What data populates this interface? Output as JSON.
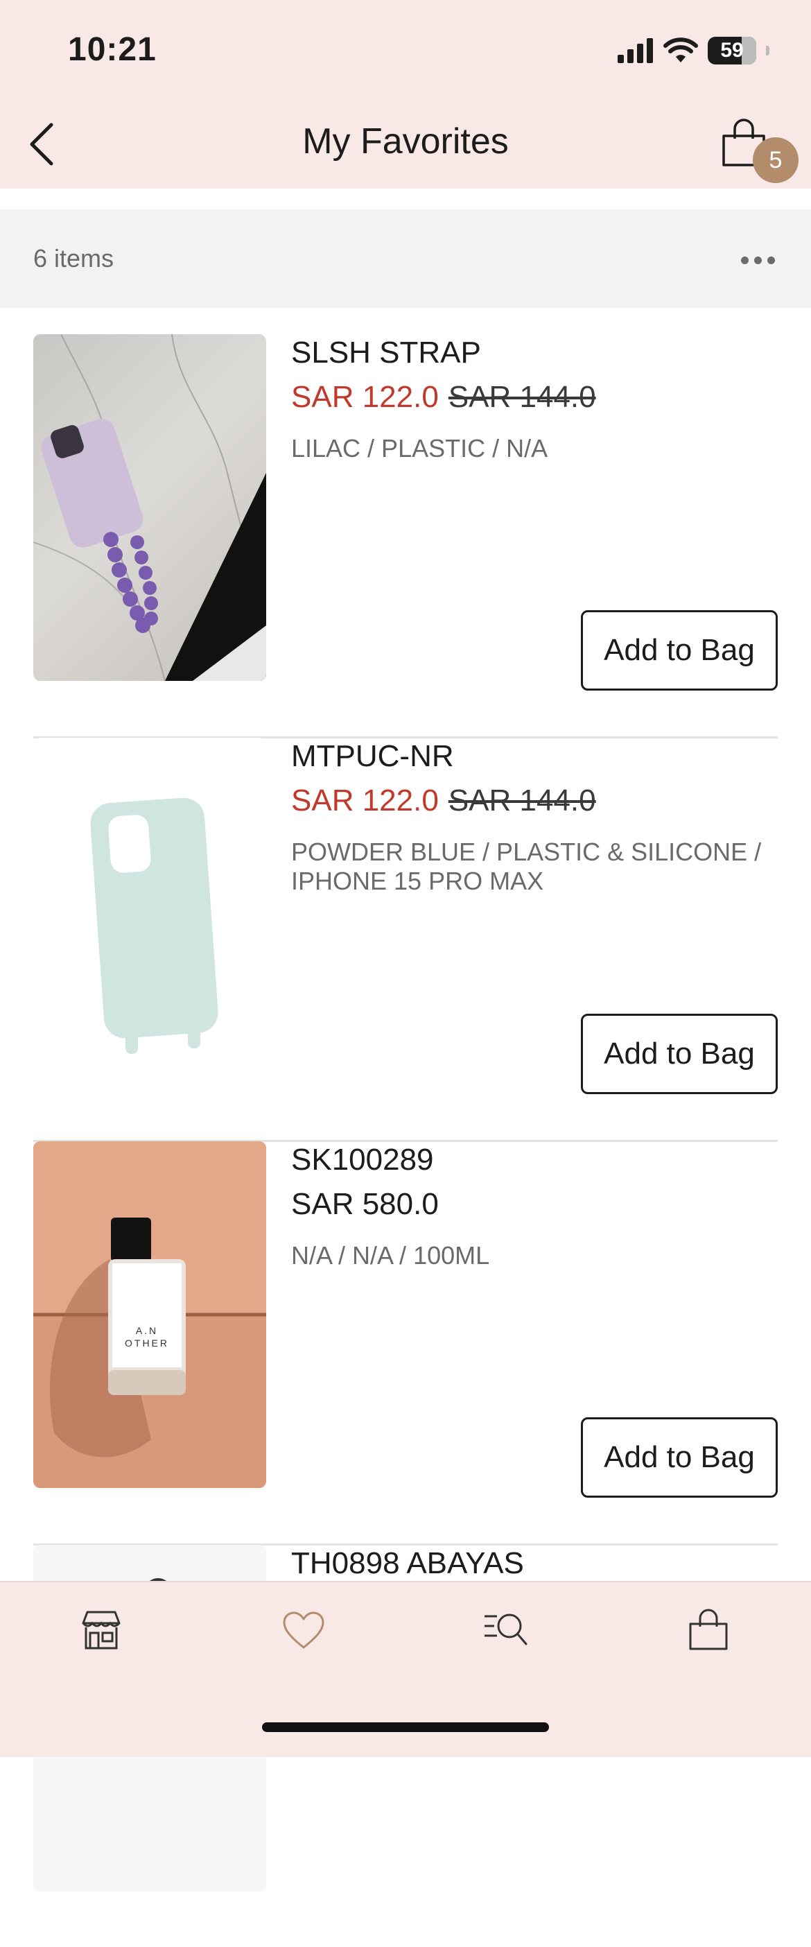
{
  "status_bar": {
    "time": "10:21",
    "battery": "59"
  },
  "header": {
    "title": "My Favorites",
    "cart_count": "5"
  },
  "list": {
    "items_count": "6 items",
    "products": [
      {
        "name": "SLSH STRAP",
        "sale_price": "SAR 122.0",
        "original_price": "SAR 144.0",
        "variant": "LILAC / PLASTIC / N/A",
        "button": "Add to Bag"
      },
      {
        "name": "MTPUC-NR",
        "sale_price": "SAR 122.0",
        "original_price": "SAR 144.0",
        "variant": "POWDER BLUE / PLASTIC & SILICONE / IPHONE 15 PRO MAX",
        "button": "Add to Bag"
      },
      {
        "name": "SK100289",
        "price": "SAR 580.0",
        "variant": "N/A / N/A / 100ML",
        "button": "Add to Bag",
        "image_text": "A.N OTHER"
      },
      {
        "name": "TH0898 ABAYAS"
      }
    ]
  },
  "tabbar": {
    "tabs": [
      {
        "icon": "store-icon"
      },
      {
        "icon": "heart-icon",
        "active": true
      },
      {
        "icon": "search-list-icon"
      },
      {
        "icon": "bag-icon"
      }
    ]
  },
  "colors": {
    "accent_sale": "#c0392b",
    "header_bg": "#f8e9e7",
    "badge": "#b38c6c"
  }
}
